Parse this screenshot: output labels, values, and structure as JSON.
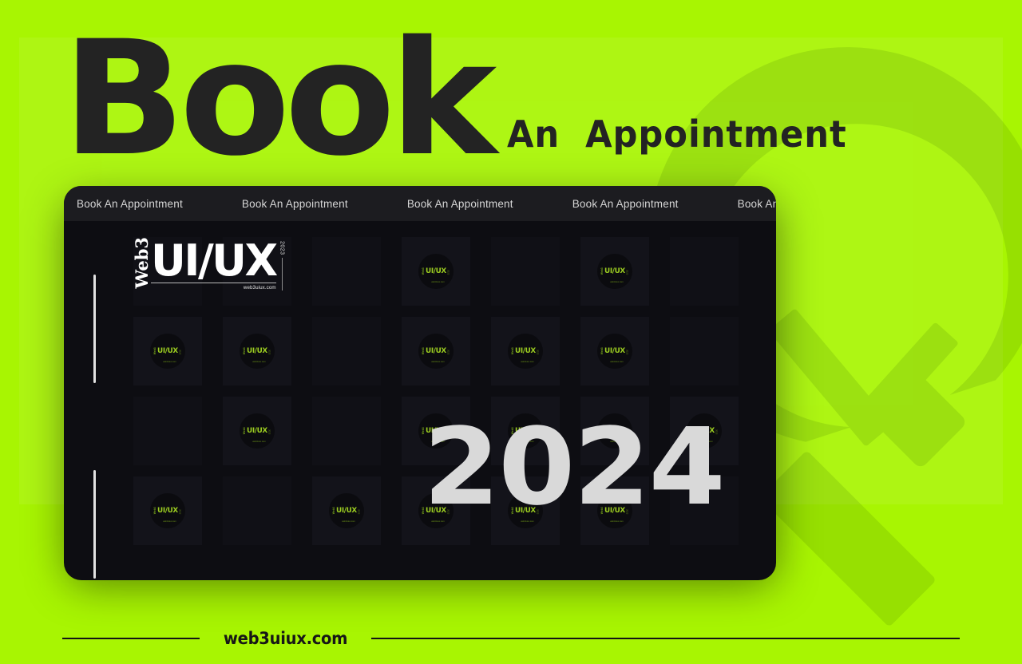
{
  "theme": {
    "accent_green": "#a8f502",
    "panel_green": "#b5f72a",
    "dark_card": "#0d0d12",
    "marquee_bar": "#1c1c20",
    "title_ink": "#232323",
    "year_gray": "#d9d9d9",
    "badge_green": "#9ccd21",
    "illustration_green": "#9bd812"
  },
  "header": {
    "title_main": "Book",
    "title_sub": "An  Appointment"
  },
  "card": {
    "marquee": {
      "items": [
        "Book An Appointment",
        "Book An Appointment",
        "Book An Appointment",
        "Book An Appointment",
        "Book An Appointment"
      ],
      "separator": "•"
    },
    "logo": {
      "prefix": "Web3",
      "main": "UI/UX",
      "year": "2023",
      "url": "web3uiux.com"
    },
    "badge": {
      "prefix": "Web3",
      "main": "UI/UX",
      "year": "2023",
      "url": "web3uiux.com"
    },
    "year_big": "2024",
    "grid": {
      "columns": 7,
      "rows": 4,
      "badge_cells": [
        [
          false,
          false,
          false,
          true,
          false,
          true,
          false
        ],
        [
          true,
          true,
          false,
          true,
          true,
          true,
          false
        ],
        [
          false,
          true,
          false,
          true,
          true,
          true,
          true
        ],
        [
          true,
          false,
          true,
          true,
          true,
          true,
          false
        ]
      ]
    }
  },
  "footer": {
    "url": "web3uiux.com"
  },
  "illustration": {
    "name": "clock-with-pencil",
    "elements": [
      "clock-ring-arc",
      "clock-hand-hour",
      "clock-hand-minute",
      "pencil"
    ]
  }
}
